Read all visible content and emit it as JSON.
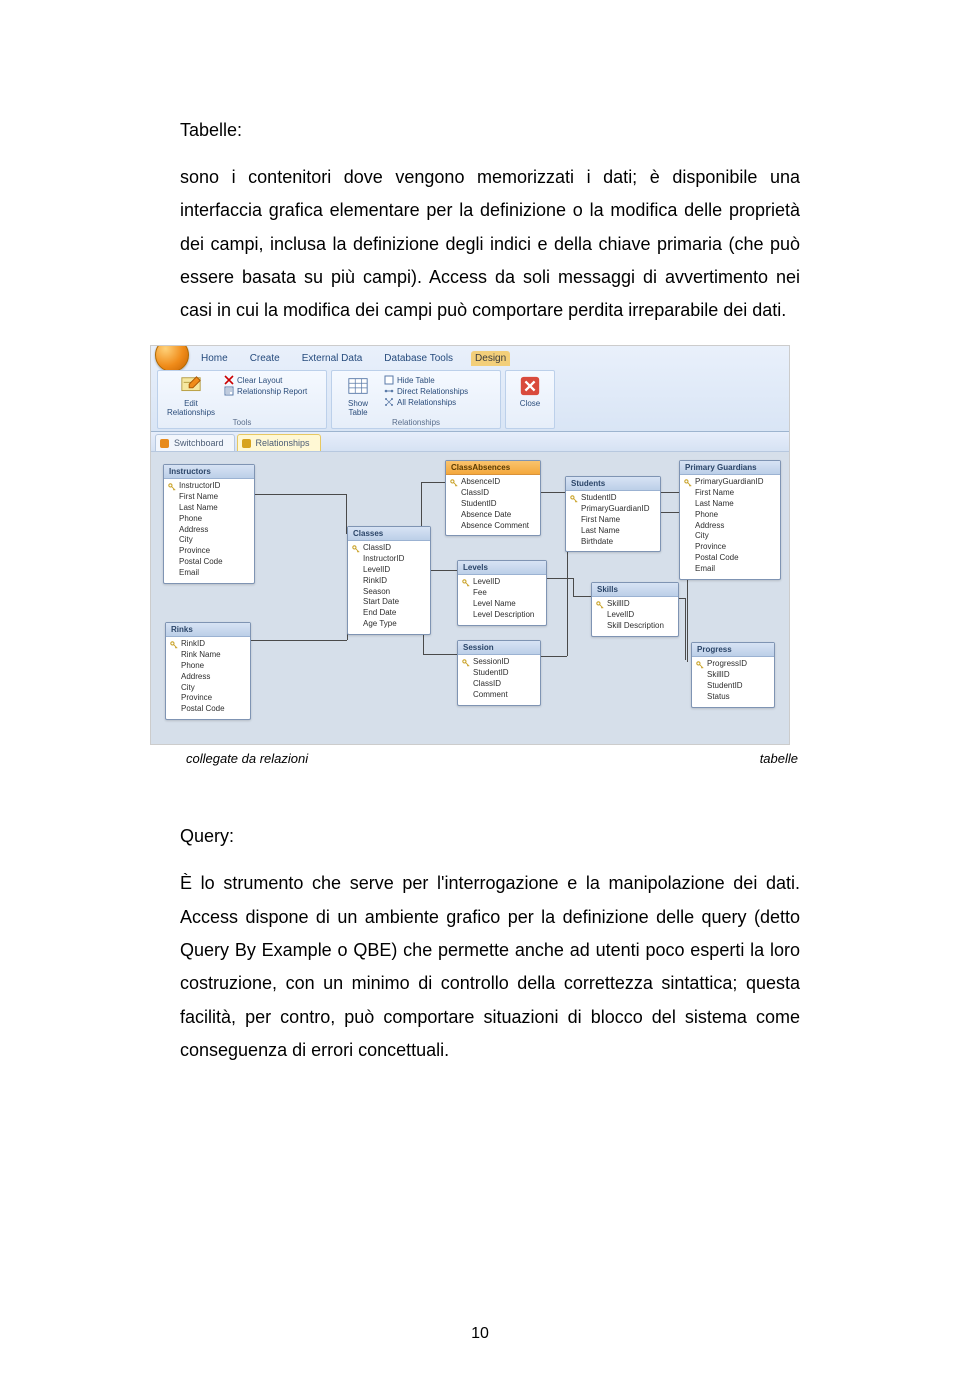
{
  "section1_title": "Tabelle:",
  "para1": "sono i contenitori dove vengono memorizzati i dati; è disponibile una interfaccia grafica elementare per la definizione o la modifica delle proprietà dei campi, inclusa la definizione degli indici e della chiave primaria (che può essere basata su più campi). Access da soli messaggi di avvertimento nei casi in cui la modifica dei campi può comportare perdita irreparabile dei dati.",
  "caption_left": "collegate da relazioni",
  "caption_right": "tabelle",
  "section2_title": "Query:",
  "para2": "È lo strumento che serve per l'interrogazione e la manipolazione dei dati. Access dispone di un ambiente grafico per la definizione delle query (detto Query By Example o QBE) che permette anche ad utenti poco esperti la loro costruzione, con un minimo di controllo della correttezza sintattica; questa facilità, per contro, può comportare situazioni di blocco del sistema come conseguenza di errori concettuali.",
  "page_number": "10",
  "fig": {
    "ribbon": {
      "tabs": [
        "Home",
        "Create",
        "External Data",
        "Database Tools",
        "Design"
      ],
      "active_tab_index": 4,
      "group1": {
        "label": "Tools",
        "big": "Edit Relationships",
        "rows": [
          "Clear Layout",
          "Relationship Report"
        ]
      },
      "group2": {
        "label": "Relationships",
        "big": "Show Table",
        "rows": [
          "Hide Table",
          "Direct Relationships",
          "All Relationships"
        ]
      },
      "group3": {
        "big": "Close"
      }
    },
    "doctabs": {
      "items": [
        "Switchboard",
        "Relationships"
      ],
      "active_index": 1
    },
    "tables": {
      "instructors": {
        "title": "Instructors",
        "fields": [
          "InstructorID",
          "First Name",
          "Last Name",
          "Phone",
          "Address",
          "City",
          "Province",
          "Postal Code",
          "Email"
        ],
        "keys": [
          0
        ]
      },
      "rinks": {
        "title": "Rinks",
        "fields": [
          "RinkID",
          "Rink Name",
          "Phone",
          "Address",
          "City",
          "Province",
          "Postal Code"
        ],
        "keys": [
          0
        ]
      },
      "classes": {
        "title": "Classes",
        "fields": [
          "ClassID",
          "InstructorID",
          "LevelID",
          "RinkID",
          "Season",
          "Start Date",
          "End Date",
          "Age Type"
        ],
        "keys": [
          0
        ]
      },
      "classabs": {
        "title": "ClassAbsences",
        "fields": [
          "AbsenceID",
          "ClassID",
          "StudentID",
          "Absence Date",
          "Absence Comment"
        ],
        "keys": [
          0
        ]
      },
      "levels": {
        "title": "Levels",
        "fields": [
          "LevelID",
          "Fee",
          "Level Name",
          "Level Description"
        ],
        "keys": [
          0
        ]
      },
      "session": {
        "title": "Session",
        "fields": [
          "SessionID",
          "StudentID",
          "ClassID",
          "Comment"
        ],
        "keys": [
          0
        ]
      },
      "students": {
        "title": "Students",
        "fields": [
          "StudentID",
          "PrimaryGuardianID",
          "First Name",
          "Last Name",
          "Birthdate"
        ],
        "keys": [
          0
        ]
      },
      "skills": {
        "title": "Skills",
        "fields": [
          "SkillID",
          "LevelID",
          "Skill Description"
        ],
        "keys": [
          0
        ]
      },
      "guardians": {
        "title": "Primary Guardians",
        "fields": [
          "PrimaryGuardianID",
          "First Name",
          "Last Name",
          "Phone",
          "Address",
          "City",
          "Province",
          "Postal Code",
          "Email"
        ],
        "keys": [
          0
        ]
      },
      "progress": {
        "title": "Progress",
        "fields": [
          "ProgressID",
          "SkillID",
          "StudentID",
          "Status"
        ],
        "keys": [
          0
        ]
      }
    }
  }
}
